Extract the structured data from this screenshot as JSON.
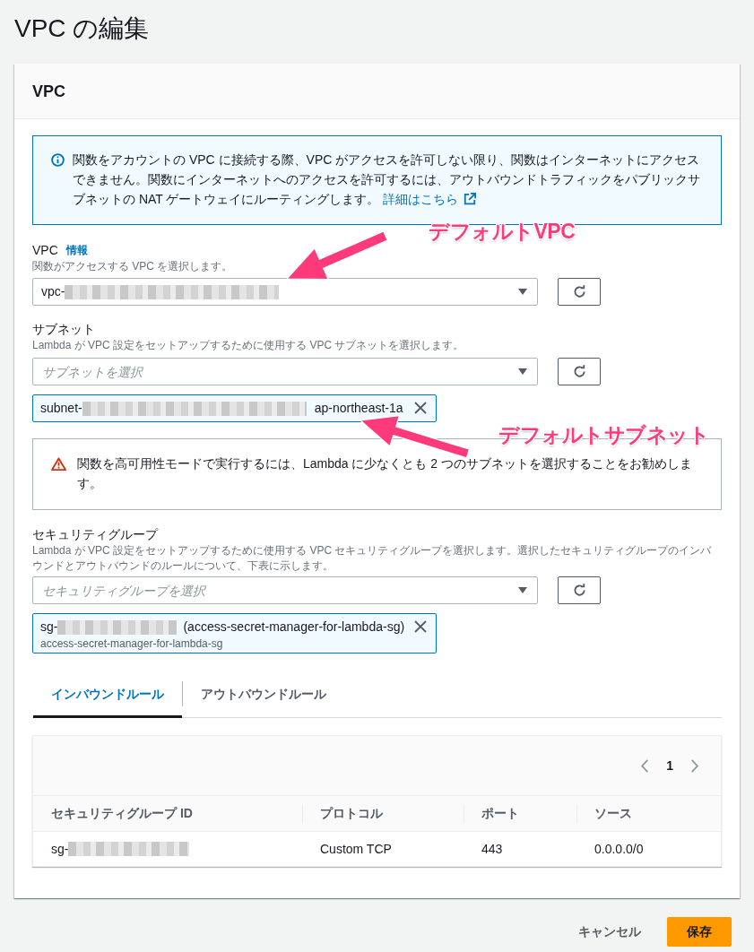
{
  "page_title": "VPC の編集",
  "panel": {
    "title": "VPC"
  },
  "info_alert": {
    "text": "関数をアカウントの VPC に接続する際、VPC がアクセスを許可しない限り、関数はインターネットにアクセスできません。関数にインターネットへのアクセスを許可するには、アウトバウンドトラフィックをパブリックサブネットの NAT ゲートウェイにルーティングします。",
    "link": "詳細はこちら"
  },
  "vpc_field": {
    "label": "VPC",
    "info_link": "情報",
    "description": "関数がアクセスする VPC を選択します。",
    "value": "vpc-",
    "redacted": true,
    "annotation": "デフォルトVPC"
  },
  "subnet_field": {
    "label": "サブネット",
    "description": "Lambda が VPC 設定をセットアップするために使用する VPC サブネットを選択します。",
    "placeholder": "サブネットを選択",
    "tokens": [
      {
        "id": "subnet-",
        "redacted": true,
        "zone": "ap-northeast-1a",
        "annotation": "デフォルトサブネット"
      }
    ]
  },
  "warning_alert": {
    "text": "関数を高可用性モードで実行するには、Lambda に少なくとも 2 つのサブネットを選択することをお勧めします。"
  },
  "security_group_field": {
    "label": "セキュリティグループ",
    "description": "Lambda が VPC 設定をセットアップするために使用する VPC セキュリティグループを選択します。選択したセキュリティグループのインバウンドとアウトバウンドのルールについて、下表に示します。",
    "placeholder": "セキュリティグループを選択",
    "tokens": [
      {
        "id": "sg-",
        "redacted": true,
        "name": "(access-secret-manager-for-lambda-sg)",
        "subtitle": "access-secret-manager-for-lambda-sg"
      }
    ]
  },
  "rule_tabs": [
    {
      "label": "インバウンドルール",
      "selected": true
    },
    {
      "label": "アウトバウンドルール",
      "selected": false
    }
  ],
  "rules_table": {
    "page": "1",
    "columns": [
      "セキュリティグループ ID",
      "プロトコル",
      "ポート",
      "ソース"
    ],
    "rows": [
      {
        "cells": [
          "sg-",
          "Custom TCP",
          "443",
          "0.0.0.0/0"
        ],
        "redacted": true
      }
    ]
  },
  "buttons": {
    "cancel": "キャンセル",
    "save": "保存"
  }
}
